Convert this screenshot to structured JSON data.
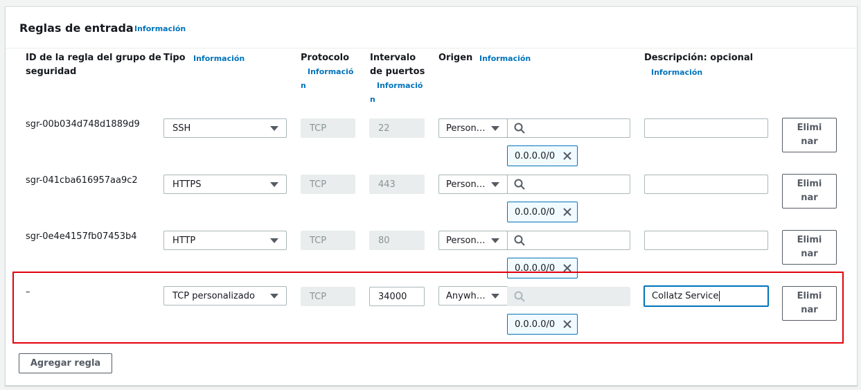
{
  "section": {
    "title": "Reglas de entrada",
    "info_link": "Información"
  },
  "columns": {
    "rule_id_line1": "ID de la regla del grupo de",
    "rule_id_line2": "seguridad",
    "type": "Tipo",
    "type_info": "Información",
    "protocol": "Protocolo",
    "protocol_info_line1": "Informació",
    "protocol_info_line2": "n",
    "port_range_line1": "Intervalo",
    "port_range_line2": "de puertos",
    "port_info_line1": "Informació",
    "port_info_line2": "n",
    "source": "Origen",
    "source_info": "Información",
    "description": "Descripción: opcional",
    "description_info": "Información"
  },
  "rules": [
    {
      "id": "sgr-00b034d748d1889d9",
      "type": "SSH",
      "protocol": "TCP",
      "port": "22",
      "source_type": "Person…",
      "cidr": "0.0.0.0/0",
      "description": "",
      "delete_line1": "Elimi",
      "delete_line2": "nar"
    },
    {
      "id": "sgr-041cba616957aa9c2",
      "type": "HTTPS",
      "protocol": "TCP",
      "port": "443",
      "source_type": "Person…",
      "cidr": "0.0.0.0/0",
      "description": "",
      "delete_line1": "Elimi",
      "delete_line2": "nar"
    },
    {
      "id": "sgr-0e4e4157fb07453b4",
      "type": "HTTP",
      "protocol": "TCP",
      "port": "80",
      "source_type": "Person…",
      "cidr": "0.0.0.0/0",
      "description": "",
      "delete_line1": "Elimi",
      "delete_line2": "nar"
    },
    {
      "id": "–",
      "type": "TCP personalizado",
      "protocol": "TCP",
      "port": "34000",
      "source_type": "Anywh…",
      "cidr": "0.0.0.0/0",
      "description": "Collatz Service",
      "delete_line1": "Elimi",
      "delete_line2": "nar"
    }
  ],
  "add_rule_button": "Agregar regla",
  "colors": {
    "link": "#0073bb",
    "highlight": "#e3000b",
    "token_border": "#0073bb",
    "token_bg": "#f1faff"
  }
}
